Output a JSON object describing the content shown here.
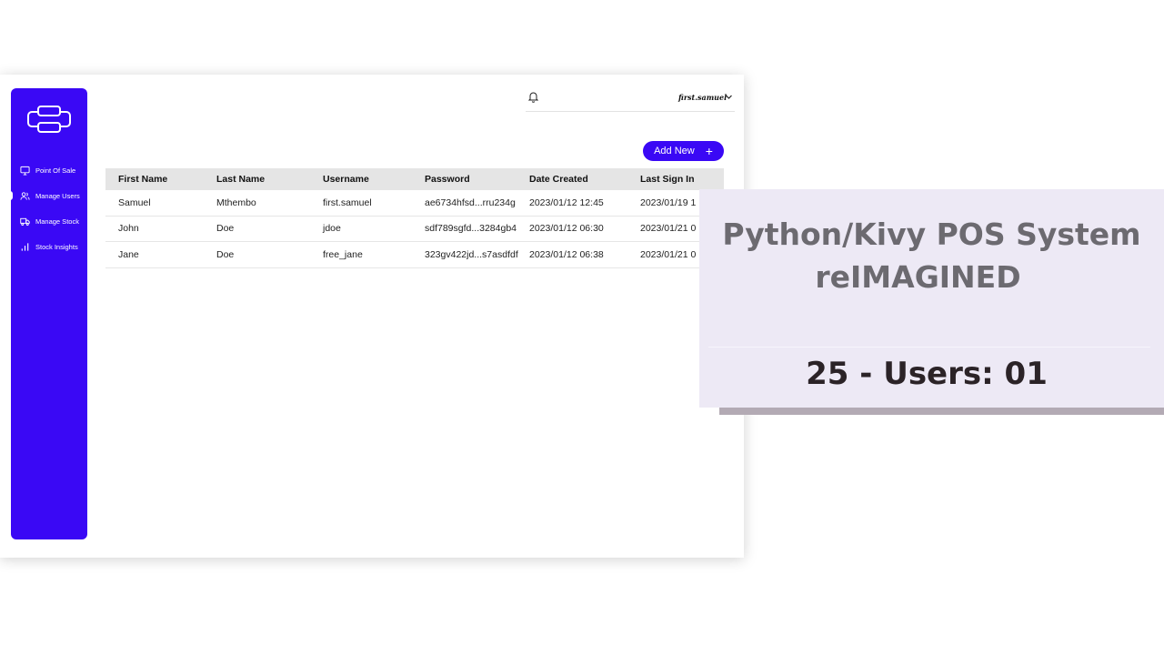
{
  "sidebar": {
    "items": [
      {
        "label": "Point Of Sale",
        "icon": "monitor-icon"
      },
      {
        "label": "Manage Users",
        "icon": "users-icon",
        "active": true
      },
      {
        "label": "Manage Stock",
        "icon": "truck-icon"
      },
      {
        "label": "Stock Insights",
        "icon": "bar-chart-icon"
      }
    ]
  },
  "topbar": {
    "username": "first.samuel"
  },
  "toolbar": {
    "add_label": "Add New",
    "add_icon": "+"
  },
  "table": {
    "headers": [
      "First Name",
      "Last Name",
      "Username",
      "Password",
      "Date Created",
      "Last Sign In"
    ],
    "rows": [
      [
        "Samuel",
        "Mthembo",
        "first.samuel",
        "ae6734hfsd...rru234g",
        "2023/01/12 12:45",
        "2023/01/19 1"
      ],
      [
        "John",
        "Doe",
        "jdoe",
        "sdf789sgfd...3284gb4",
        "2023/01/12 06:30",
        "2023/01/21 0"
      ],
      [
        "Jane",
        "Doe",
        "free_jane",
        "323gv422jd...s7asdfdf",
        "2023/01/12 06:38",
        "2023/01/21 0"
      ]
    ]
  },
  "overlay": {
    "title_line1": "Python/Kivy POS System",
    "title_line2": "reIMAGINED",
    "subtitle": "25 - Users: 01"
  },
  "colors": {
    "accent": "#3a08f5",
    "overlay_bg": "#ede9f5",
    "overlay_title": "#6c6a70",
    "overlay_subtitle": "#2b2327"
  }
}
